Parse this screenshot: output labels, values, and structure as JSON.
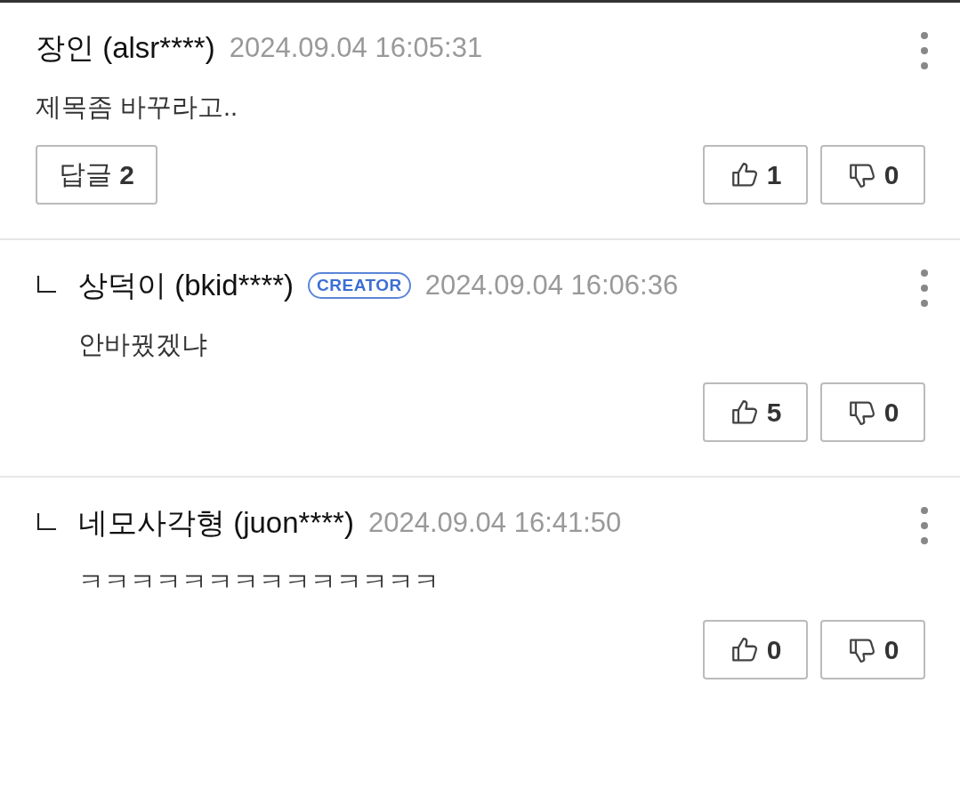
{
  "comments": [
    {
      "kind": "comment",
      "author": "장인 (alsr****)",
      "time": "2024.09.04 16:05:31",
      "text": "제목좀 바꾸라고..",
      "reply_label": "답글",
      "reply_count": "2",
      "likes": "1",
      "dislikes": "0"
    },
    {
      "kind": "reply",
      "author": "상덕이 (bkid****)",
      "badge": "CREATOR",
      "time": "2024.09.04 16:06:36",
      "text": "안바꿨겠냐",
      "likes": "5",
      "dislikes": "0"
    },
    {
      "kind": "reply",
      "author": "네모사각형 (juon****)",
      "time": "2024.09.04 16:41:50",
      "text": "ㅋㅋㅋㅋㅋㅋㅋㅋㅋㅋㅋㅋㅋㅋ",
      "likes": "0",
      "dislikes": "0"
    }
  ]
}
